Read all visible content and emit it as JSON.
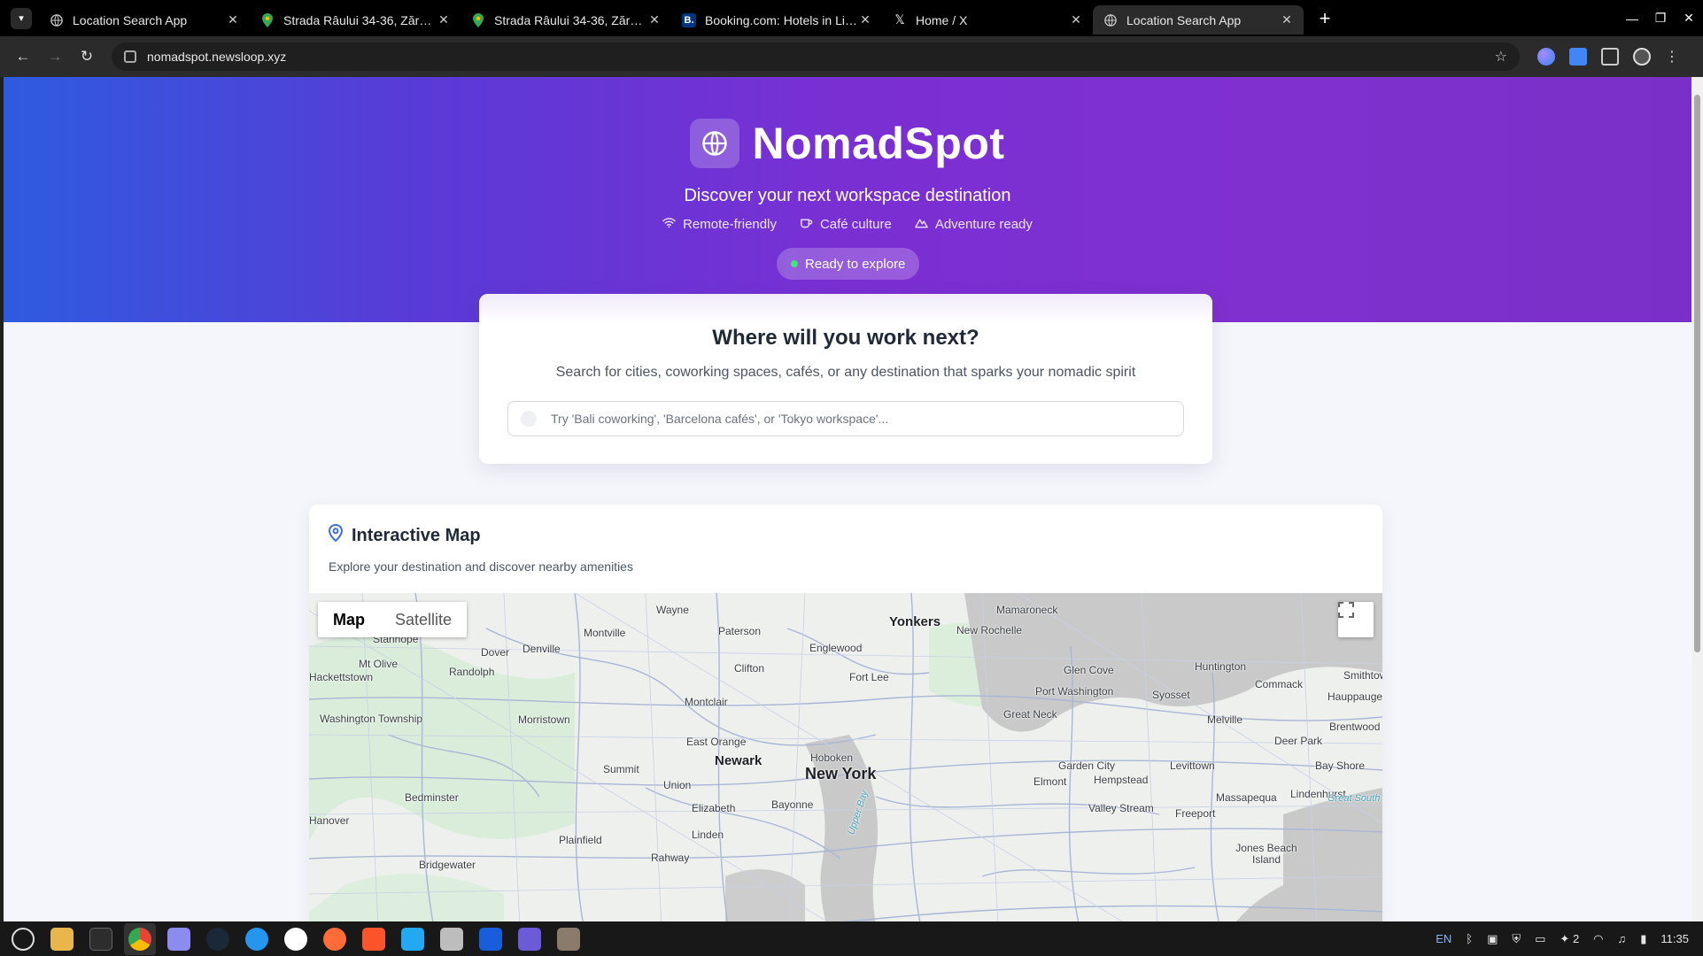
{
  "browser": {
    "tabs": [
      {
        "title": "Location Search App",
        "icon": "globe-icon",
        "active": false
      },
      {
        "title": "Strada Râului 34-36, Zărnești",
        "icon": "maps-pin-icon",
        "active": false
      },
      {
        "title": "Strada Râului 34-36, Zărnești",
        "icon": "maps-pin-icon",
        "active": false
      },
      {
        "title": "Booking.com: Hotels in Lisbon",
        "icon": "booking-icon",
        "active": false
      },
      {
        "title": "Home / X",
        "icon": "x-icon",
        "active": false
      },
      {
        "title": "Location Search App",
        "icon": "globe-icon",
        "active": true
      }
    ],
    "url": "nomadspot.newsloop.xyz"
  },
  "hero": {
    "brand": "NomadSpot",
    "tagline": "Discover your next workspace destination",
    "features": [
      "Remote-friendly",
      "Café culture",
      "Adventure ready"
    ],
    "status": "Ready to explore"
  },
  "search": {
    "title": "Where will you work next?",
    "subtitle": "Search for cities, coworking spaces, cafés, or any destination that sparks your nomadic spirit",
    "placeholder": "Try 'Bali coworking', 'Barcelona cafés', or 'Tokyo workspace'..."
  },
  "map_section": {
    "title": "Interactive Map",
    "subtitle": "Explore your destination and discover nearby amenities",
    "map_type_buttons": [
      "Map",
      "Satellite"
    ],
    "selected_map_type": "Map",
    "place_labels": {
      "big": [
        "New York"
      ],
      "mid": [
        "Yonkers",
        "Newark"
      ],
      "small": [
        "Wayne",
        "Paterson",
        "Mamaroneck",
        "New Rochelle",
        "Stanhope",
        "Montville",
        "Denville",
        "Dover",
        "Englewood",
        "Mt Olive",
        "Randolph",
        "Clifton",
        "Fort Lee",
        "Glen Cove",
        "Huntington",
        "Smithtown",
        "Commack",
        "Hauppauge",
        "Hackettstown",
        "Port Washington",
        "Syosset",
        "Montclair",
        "Great Neck",
        "Melville",
        "Brentwood",
        "Washington Township",
        "Morristown",
        "East Orange",
        "Hoboken",
        "Deer Park",
        "Summit",
        "Union",
        "Garden City",
        "Levittown",
        "Bay Shore",
        "Hempstead",
        "Elmont",
        "Bedminster",
        "Elizabeth",
        "Bayonne",
        "Massapequa",
        "Lindenhurst",
        "Valley Stream",
        "Freeport",
        "Plainfield",
        "Linden",
        "Rahway",
        "Bridgewater",
        "Jones Beach Island",
        "Hanover"
      ],
      "water": [
        "Upper Bay",
        "Great South Bay"
      ]
    }
  },
  "taskbar": {
    "tray": {
      "lang": "EN",
      "notif_count": "2",
      "time": "11:35"
    }
  },
  "colors": {
    "hero_start": "#2e5be0",
    "hero_end": "#7a30c8",
    "status_dot": "#4ade80"
  }
}
